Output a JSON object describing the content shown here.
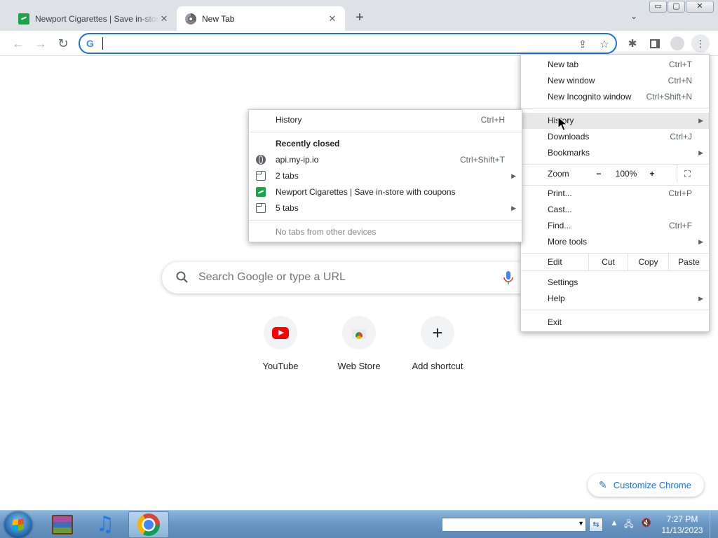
{
  "tabs": [
    {
      "title": "Newport Cigarettes | Save in-store with coupons",
      "active": false
    },
    {
      "title": "New Tab",
      "active": true
    }
  ],
  "window_controls": {
    "minimize": "▭",
    "maximize": "▢",
    "close": "✕"
  },
  "omnibox": {
    "value": "",
    "google_letter": "G"
  },
  "search": {
    "placeholder": "Search Google or type a URL"
  },
  "shortcuts": [
    {
      "label": "YouTube",
      "icon": "youtube-icon"
    },
    {
      "label": "Web Store",
      "icon": "web-store-icon"
    },
    {
      "label": "Add shortcut",
      "icon": "plus-icon"
    }
  ],
  "customize": {
    "label": "Customize Chrome"
  },
  "menu": {
    "new_tab": {
      "label": "New tab",
      "shortcut": "Ctrl+T"
    },
    "new_window": {
      "label": "New window",
      "shortcut": "Ctrl+N"
    },
    "incognito": {
      "label": "New Incognito window",
      "shortcut": "Ctrl+Shift+N"
    },
    "history": {
      "label": "History"
    },
    "downloads": {
      "label": "Downloads",
      "shortcut": "Ctrl+J"
    },
    "bookmarks": {
      "label": "Bookmarks"
    },
    "zoom": {
      "label": "Zoom",
      "minus": "−",
      "value": "100%",
      "plus": "+"
    },
    "print": {
      "label": "Print...",
      "shortcut": "Ctrl+P"
    },
    "cast": {
      "label": "Cast..."
    },
    "find": {
      "label": "Find...",
      "shortcut": "Ctrl+F"
    },
    "more_tools": {
      "label": "More tools"
    },
    "edit": {
      "label": "Edit",
      "cut": "Cut",
      "copy": "Copy",
      "paste": "Paste"
    },
    "settings": {
      "label": "Settings"
    },
    "help": {
      "label": "Help"
    },
    "exit": {
      "label": "Exit"
    }
  },
  "history_menu": {
    "history": {
      "label": "History",
      "shortcut": "Ctrl+H"
    },
    "recently_closed": "Recently closed",
    "items": [
      {
        "label": "api.my-ip.io",
        "shortcut": "Ctrl+Shift+T",
        "icon": "globe-icon"
      },
      {
        "label": "2 tabs",
        "icon": "tab-icon"
      },
      {
        "label": "Newport Cigarettes | Save in-store with coupons",
        "icon": "newport-favicon-icon"
      },
      {
        "label": "5 tabs",
        "icon": "tab-icon"
      }
    ],
    "no_other_devices": "No tabs from other devices"
  },
  "taskbar": {
    "apps": [
      "winrar-icon",
      "itunes-icon",
      "chrome-icon"
    ],
    "clock_time": "7:27 PM",
    "clock_date": "11/13/2023"
  }
}
